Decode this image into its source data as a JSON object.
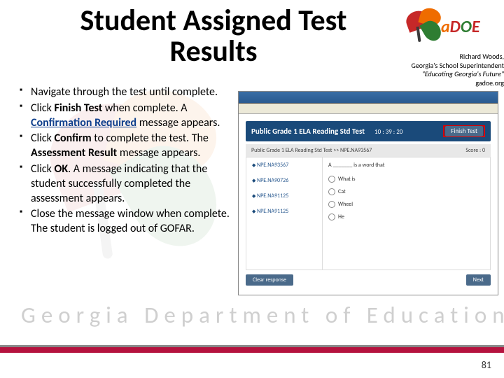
{
  "title": "Student Assigned Test Results",
  "attribution": {
    "name": "Richard Woods,",
    "role": "Georgia's School Superintendent",
    "motto": "\"Educating Georgia's Future\"",
    "site": "gadoe.org"
  },
  "logo": {
    "a": "a",
    "d": "D",
    "o": "O",
    "e": "E"
  },
  "bg_text": "Georgia Department of Education",
  "bullets": [
    {
      "pre": "Navigate through the test until complete."
    },
    {
      "pre": "Click ",
      "b1": "Finish Test",
      "mid": " when complete. A ",
      "link": "Confirmation Required",
      "post": " message appears."
    },
    {
      "pre": "Click ",
      "b1": "Confirm",
      "mid": " to complete the test. The ",
      "b2": "Assessment Result",
      "post": " message appears."
    },
    {
      "pre": "Click ",
      "b1": "OK",
      "post": ". A message indicating that the student successfully completed the assessment appears."
    },
    {
      "pre": "Close the message window when complete. The student is logged out of GOFAR."
    }
  ],
  "screenshot": {
    "header_title": "Public Grade 1 ELA Reading Std Test",
    "header_time": "10 : 39 : 20",
    "finish_btn": "Finish Test",
    "breadcrumb_left": "Public Grade 1 ELA Reading Std Test >> NPE.NA93567",
    "breadcrumb_right": "Score : 0",
    "left_items": [
      "NPE.NA93567",
      "NPE.NA90726",
      "NPE.NA91125",
      "NPE.NA91125"
    ],
    "question": "A _______ is a word that",
    "options": [
      "What is",
      "Cat",
      "Wheel",
      "He"
    ],
    "footer_left": "Clear response",
    "footer_right": "Next"
  },
  "page_num": "81"
}
